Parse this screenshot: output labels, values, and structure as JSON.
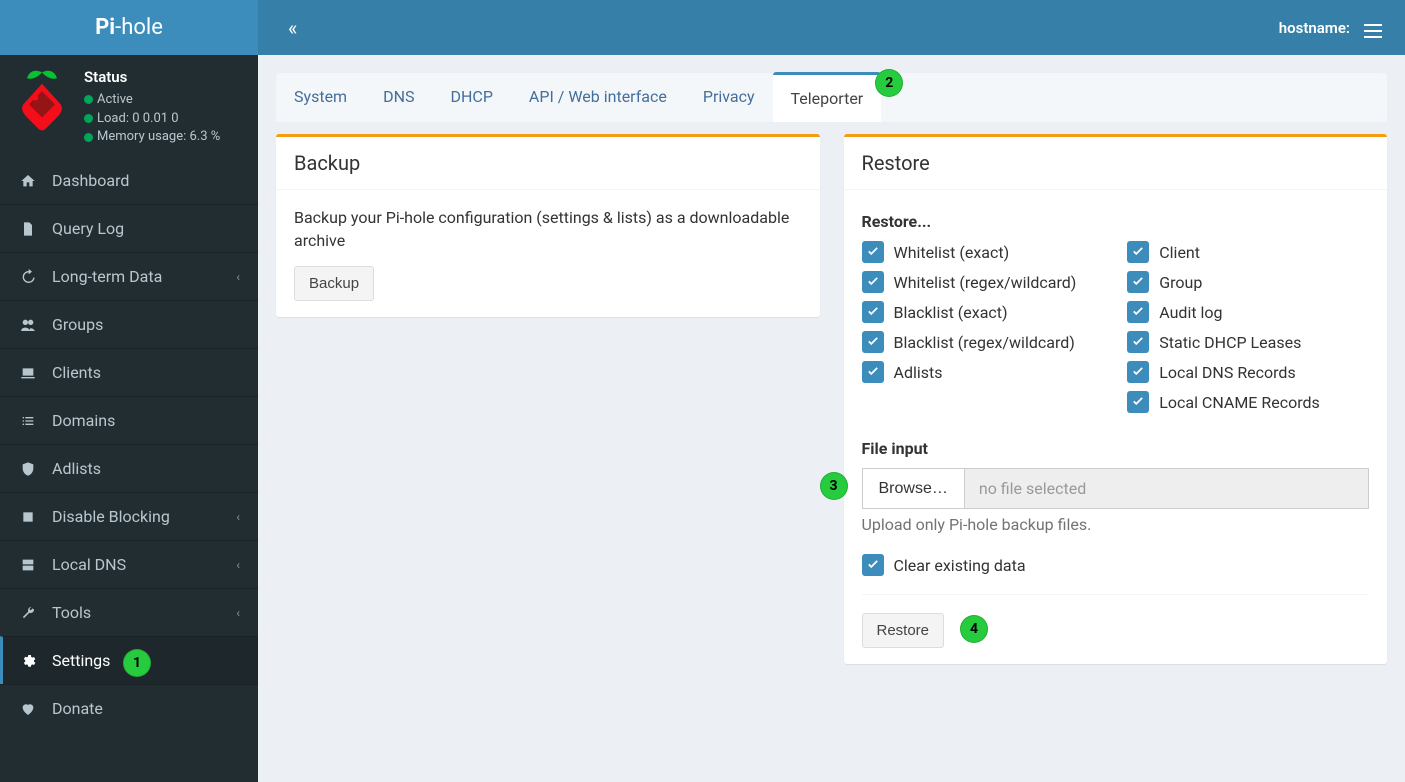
{
  "app": {
    "logo_html": "Pi-hole",
    "hostname_label": "hostname:"
  },
  "status": {
    "title": "Status",
    "active": "Active",
    "load_label": "Load:",
    "load_values": "0  0.01  0",
    "mem_label": "Memory usage:",
    "mem_value": "6.3 %"
  },
  "nav": [
    {
      "id": "dashboard",
      "label": "Dashboard",
      "icon": "home"
    },
    {
      "id": "querylog",
      "label": "Query Log",
      "icon": "file"
    },
    {
      "id": "longterm",
      "label": "Long-term Data",
      "icon": "history",
      "expandable": true
    },
    {
      "id": "groups",
      "label": "Groups",
      "icon": "users"
    },
    {
      "id": "clients",
      "label": "Clients",
      "icon": "laptop"
    },
    {
      "id": "domains",
      "label": "Domains",
      "icon": "list"
    },
    {
      "id": "adlists",
      "label": "Adlists",
      "icon": "shield"
    },
    {
      "id": "disable",
      "label": "Disable Blocking",
      "icon": "stop",
      "expandable": true
    },
    {
      "id": "localdns",
      "label": "Local DNS",
      "icon": "drive",
      "expandable": true
    },
    {
      "id": "tools",
      "label": "Tools",
      "icon": "wrench",
      "expandable": true
    },
    {
      "id": "settings",
      "label": "Settings",
      "icon": "cog",
      "active": true
    },
    {
      "id": "donate",
      "label": "Donate",
      "icon": "heart"
    }
  ],
  "tabs": [
    "System",
    "DNS",
    "DHCP",
    "API / Web interface",
    "Privacy",
    "Teleporter"
  ],
  "active_tab_index": 5,
  "backup": {
    "heading": "Backup",
    "description": "Backup your Pi-hole configuration (settings & lists) as a downloadable archive",
    "button": "Backup"
  },
  "restore": {
    "heading": "Restore",
    "sub": "Restore...",
    "options_left": [
      "Whitelist (exact)",
      "Whitelist (regex/wildcard)",
      "Blacklist (exact)",
      "Blacklist (regex/wildcard)",
      "Adlists"
    ],
    "options_right": [
      "Client",
      "Group",
      "Audit log",
      "Static DHCP Leases",
      "Local DNS Records",
      "Local CNAME Records"
    ],
    "file_label": "File input",
    "browse": "Browse…",
    "no_file": "no file selected",
    "upload_hint": "Upload only Pi-hole backup files.",
    "clear": "Clear existing data",
    "button": "Restore"
  },
  "callouts": {
    "1": "1",
    "2": "2",
    "3": "3",
    "4": "4"
  }
}
